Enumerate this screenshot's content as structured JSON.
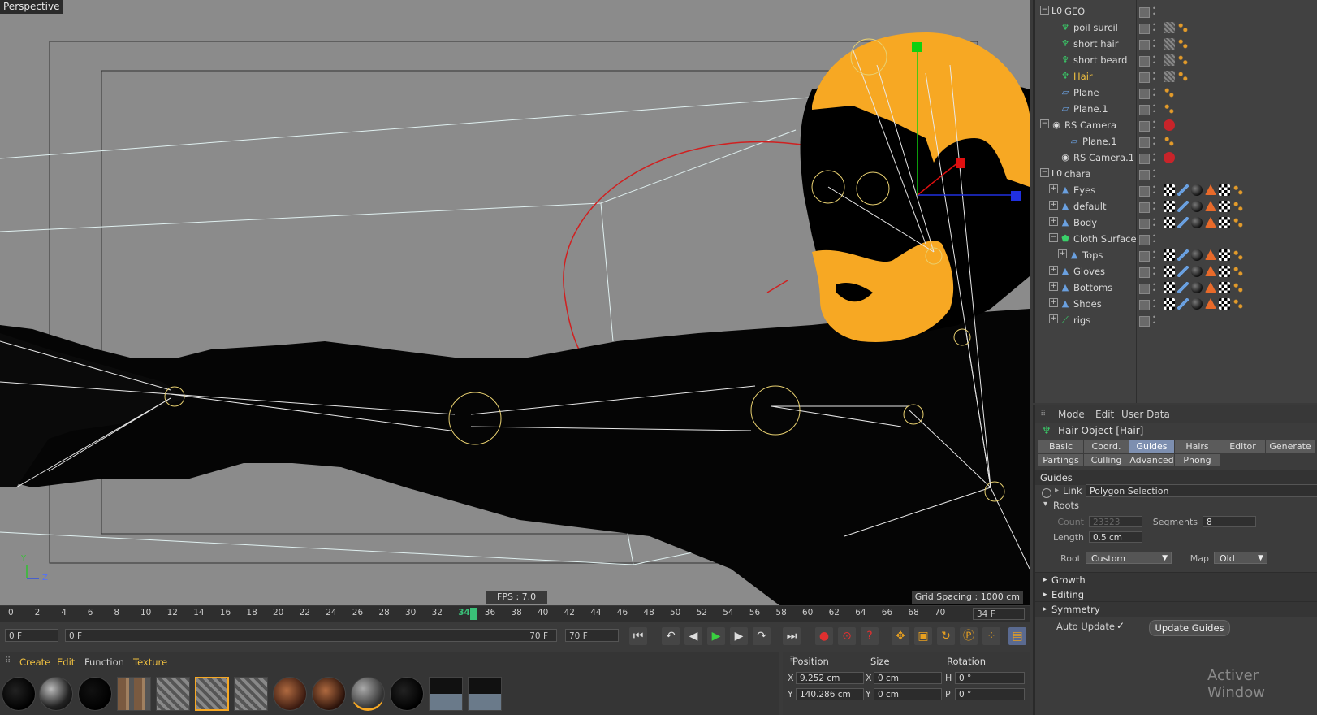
{
  "viewport": {
    "label": "Perspective",
    "fps": "FPS : 7.0",
    "grid_spacing": "Grid Spacing : 1000 cm",
    "axis_y": "Y",
    "axis_z": "Z"
  },
  "objects": [
    {
      "name": "GEO",
      "level": 0,
      "tree": "minus",
      "icon": "null-icon"
    },
    {
      "name": "poil surcil",
      "level": 1,
      "tree": "none",
      "icon": "hair-icon"
    },
    {
      "name": "short hair",
      "level": 1,
      "tree": "none",
      "icon": "hair-icon"
    },
    {
      "name": "short beard",
      "level": 1,
      "tree": "none",
      "icon": "hair-icon"
    },
    {
      "name": "Hair",
      "level": 1,
      "tree": "none",
      "icon": "hair-icon",
      "selected": true
    },
    {
      "name": "Plane",
      "level": 1,
      "tree": "none",
      "icon": "plane-icon"
    },
    {
      "name": "Plane.1",
      "level": 1,
      "tree": "none",
      "icon": "plane-icon"
    },
    {
      "name": "RS Camera",
      "level": 0,
      "tree": "minus",
      "icon": "camera-icon"
    },
    {
      "name": "Plane.1",
      "level": 2,
      "tree": "none",
      "icon": "plane-icon"
    },
    {
      "name": "RS Camera.1",
      "level": 1,
      "tree": "none",
      "icon": "camera-icon"
    },
    {
      "name": "chara",
      "level": 0,
      "tree": "minus",
      "icon": "null-icon"
    },
    {
      "name": "Eyes",
      "level": 1,
      "tree": "plus",
      "icon": "polygon-icon"
    },
    {
      "name": "default",
      "level": 1,
      "tree": "plus",
      "icon": "polygon-icon"
    },
    {
      "name": "Body",
      "level": 1,
      "tree": "plus",
      "icon": "polygon-icon"
    },
    {
      "name": "Cloth Surface",
      "level": 1,
      "tree": "minus",
      "icon": "cloth-icon"
    },
    {
      "name": "Tops",
      "level": 2,
      "tree": "plus",
      "icon": "polygon-icon"
    },
    {
      "name": "Gloves",
      "level": 1,
      "tree": "plus",
      "icon": "polygon-icon"
    },
    {
      "name": "Bottoms",
      "level": 1,
      "tree": "plus",
      "icon": "polygon-icon"
    },
    {
      "name": "Shoes",
      "level": 1,
      "tree": "plus",
      "icon": "polygon-icon"
    },
    {
      "name": "rigs",
      "level": 1,
      "tree": "plus",
      "icon": "bone-icon"
    }
  ],
  "attr": {
    "menu": [
      "Mode",
      "Edit",
      "User Data"
    ],
    "object_title": "Hair Object [Hair]",
    "tabs_row1": [
      "Basic",
      "Coord.",
      "Guides",
      "Hairs",
      "Editor",
      "Generate"
    ],
    "tabs_row2": [
      "Partings",
      "Culling",
      "Advanced",
      "Phong"
    ],
    "active_tab": "Guides",
    "section": "Guides",
    "link_label": "Link",
    "link_value": "Polygon Selection",
    "roots_label": "Roots",
    "count_label": "Count",
    "count_value": "23323",
    "segments_label": "Segments",
    "segments_value": "8",
    "length_label": "Length",
    "length_value": "0.5 cm",
    "root_label": "Root",
    "root_value": "Custom",
    "map_label": "Map",
    "map_value": "Old",
    "collapsed": [
      "Growth",
      "Editing",
      "Symmetry"
    ],
    "auto_update_label": "Auto Update",
    "auto_update_check": "✓",
    "update_guides_button": "Update Guides",
    "watermark": "Activer Window"
  },
  "timeline": {
    "ticks": [
      "0",
      "2",
      "4",
      "6",
      "8",
      "10",
      "12",
      "14",
      "16",
      "18",
      "20",
      "22",
      "24",
      "26",
      "28",
      "30",
      "32",
      "34",
      "36",
      "38",
      "40",
      "42",
      "44",
      "46",
      "48",
      "50",
      "52",
      "54",
      "56",
      "58",
      "60",
      "62",
      "64",
      "66",
      "68",
      "70"
    ],
    "current_frame": "34",
    "current_frame_field": "34 F"
  },
  "playbar": {
    "start_field": "0 F",
    "range_start": "0 F",
    "range_end": "70 F",
    "end_field": "70 F"
  },
  "materials": {
    "menu": [
      "Create",
      "Edit",
      "Function",
      "Texture"
    ]
  },
  "coords": {
    "headers": [
      "Position",
      "Size",
      "Rotation"
    ],
    "x_label": "X",
    "y_label": "Y",
    "h_label": "H",
    "p_label": "P",
    "pos_x": "9.252 cm",
    "pos_y": "140.286 cm",
    "size_x": "0 cm",
    "size_y": "0 cm",
    "rot_h": "0 °",
    "rot_p": "0 °"
  },
  "colors": {
    "accent": "#f7a823",
    "selected_text": "#f0c040",
    "tab_active": "#7d8fb0"
  }
}
